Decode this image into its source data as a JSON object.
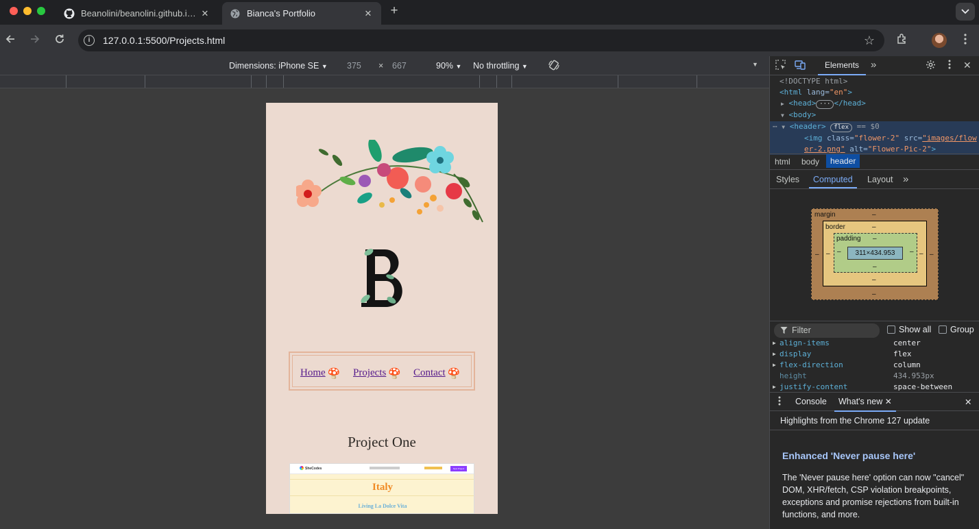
{
  "browser": {
    "tabs": [
      {
        "title": "Beanolini/beanolini.github.io at",
        "icon": "github-icon"
      },
      {
        "title": "Bianca's Portfolio",
        "icon": "globe-icon"
      }
    ],
    "url": "127.0.0.1:5500/Projects.html"
  },
  "device_toolbar": {
    "dimensions_label": "Dimensions: iPhone SE",
    "width": "375",
    "times": "×",
    "height": "667",
    "zoom": "90%",
    "throttling": "No throttling"
  },
  "page": {
    "nav": [
      {
        "label": "Home",
        "emoji": "🍄"
      },
      {
        "label": "Projects",
        "emoji": "🍄"
      },
      {
        "label": "Contact",
        "emoji": "🍄"
      }
    ],
    "project_title": "Project One",
    "preview": {
      "brand": "SheCodes",
      "title": "Italy",
      "subtitle": "Living La Dolce Vita",
      "button": "Next Project"
    }
  },
  "devtools": {
    "tab_elements": "Elements",
    "code": {
      "doctype": "<!DOCTYPE html>",
      "html_open": "<html",
      "lang_attr": " lang=",
      "lang_val": "\"en\"",
      "gt": ">",
      "head_open": "<head>",
      "head_dots": "···",
      "head_close": "</head>",
      "body_open": "<body>",
      "header_open": "<header>",
      "flex_badge": "flex",
      "eq_ref": " == $0",
      "img_open": "<img",
      "class_attr": " class=",
      "class_val": "\"flower-2\"",
      "src_attr": " src=",
      "src_val_1": "\"images/flow",
      "src_val_2": "er-2.png\"",
      "alt_attr": " alt=",
      "alt_val": "\"Flower-Pic-2\"",
      "img_close": ">"
    },
    "breadcrumbs": [
      "html",
      "body",
      "header"
    ],
    "subtabs": [
      "Styles",
      "Computed",
      "Layout"
    ],
    "box_model": {
      "margin_label": "margin",
      "border_label": "border",
      "padding_label": "padding",
      "content_size": "311×434.953",
      "dash": "–"
    },
    "filter_placeholder": "Filter",
    "show_all": "Show all",
    "group": "Group",
    "computed": [
      {
        "name": "align-items",
        "value": "center",
        "expandable": true
      },
      {
        "name": "display",
        "value": "flex",
        "expandable": true
      },
      {
        "name": "flex-direction",
        "value": "column",
        "expandable": true
      },
      {
        "name": "height",
        "value": "434.953px",
        "expandable": false
      },
      {
        "name": "justify-content",
        "value": "space-between",
        "expandable": true
      }
    ],
    "drawer": {
      "console": "Console",
      "whats_new": "What's new",
      "highlights": "Highlights from the Chrome 127 update",
      "article_title": "Enhanced 'Never pause here'",
      "article_body": "The 'Never pause here' option can now \"cancel\" DOM, XHR/fetch, CSP violation breakpoints, exceptions and promise rejections from built-in functions, and more."
    }
  }
}
